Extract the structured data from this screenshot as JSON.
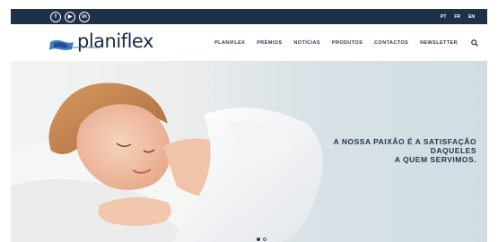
{
  "social": {
    "facebook_label": "f",
    "youtube_label": "▶",
    "linkedin_label": "in"
  },
  "languages": [
    "PT",
    "FR",
    "EN"
  ],
  "logo": {
    "name": "planiflex",
    "tagline": "indústria de colchões"
  },
  "nav": {
    "items": [
      "PLANIFLEX",
      "PRÉMIOS",
      "NOTÍCIAS",
      "PRODUTOS",
      "CONTACTOS",
      "NEWSLETTER"
    ]
  },
  "hero": {
    "tagline_lines": [
      "A NOSSA PAIXÃO É A SATISFAÇÃO",
      "DAQUELES",
      "A QUEM SERVIMOS."
    ]
  },
  "slider": {
    "active_index": 0,
    "count": 2
  },
  "colors": {
    "topbar": "#1f3049",
    "brand": "#1a2b45",
    "accent": "#2f5f9e"
  }
}
